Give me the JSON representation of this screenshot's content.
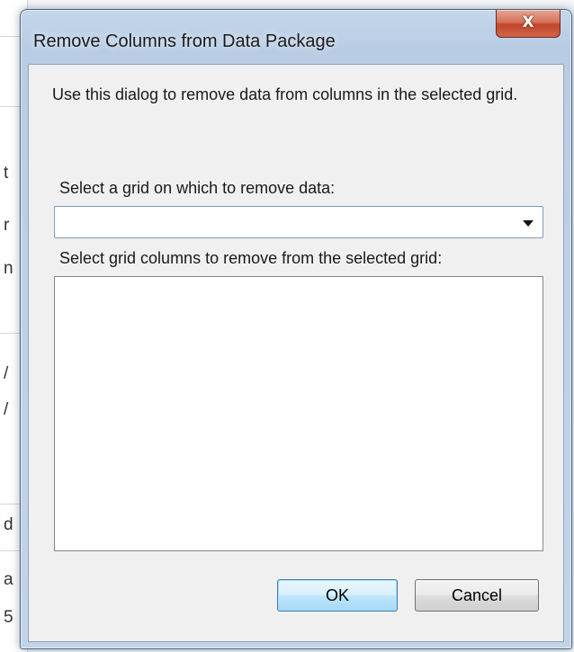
{
  "background": {
    "fragments": [
      "t",
      "r",
      "n",
      "/",
      "/",
      "d",
      "a",
      "5"
    ]
  },
  "dialog": {
    "title": "Remove Columns from Data Package",
    "close_glyph": "X",
    "description": "Use this dialog to remove data from columns in the selected grid.",
    "grid_select": {
      "label": "Select a grid on which to remove data:",
      "value": ""
    },
    "columns_list": {
      "label": "Select grid columns to remove from the selected grid:",
      "items": []
    },
    "buttons": {
      "ok": "OK",
      "cancel": "Cancel"
    }
  },
  "colors": {
    "frame": "#bdd0e6",
    "close_button": "#c2452b",
    "default_button_border": "#3c7fb1"
  }
}
